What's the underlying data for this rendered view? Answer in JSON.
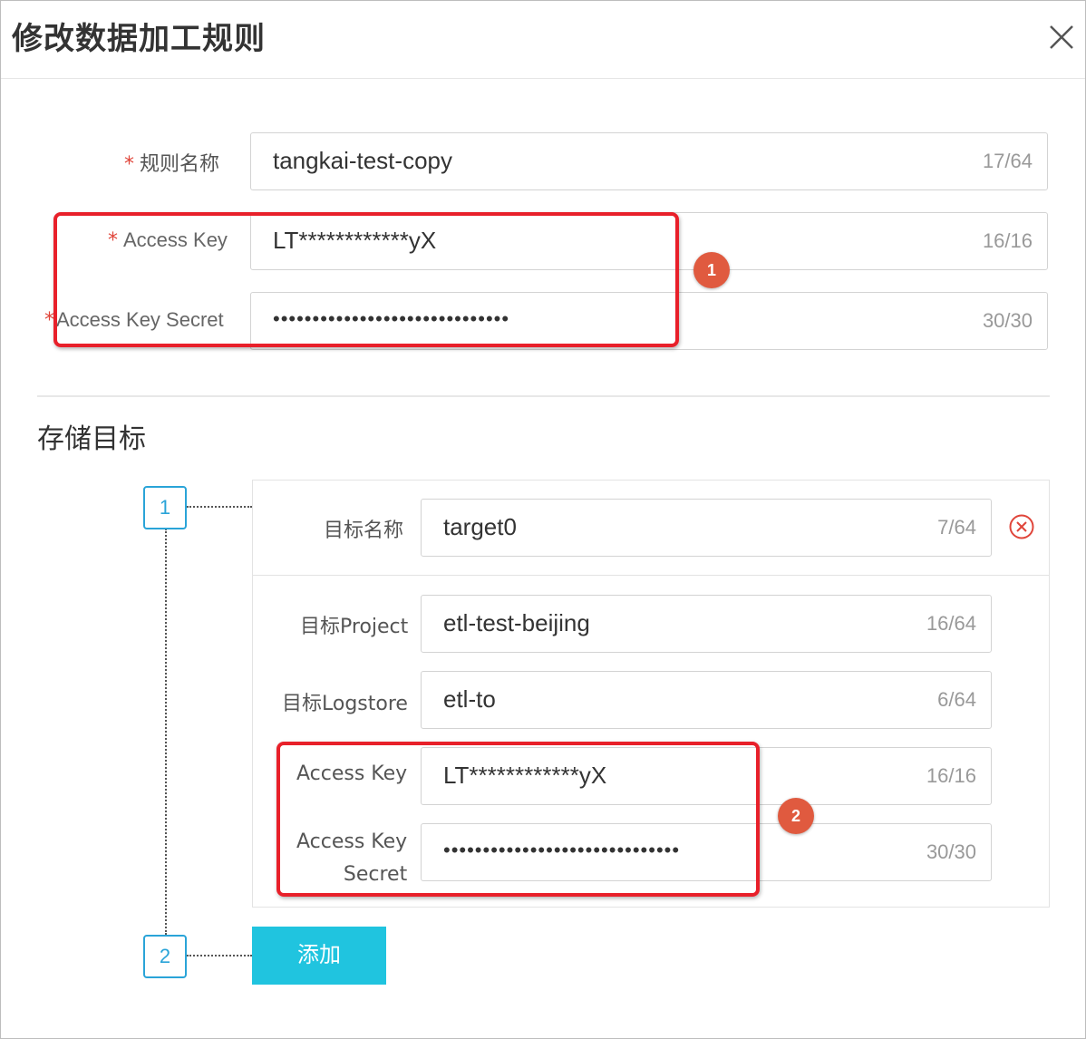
{
  "dialog": {
    "title": "修改数据加工规则",
    "close_icon": "close-icon"
  },
  "rule": {
    "name": {
      "label": "规则名称",
      "value": "tangkai-test-copy",
      "count": "17/64",
      "required": "*"
    },
    "access_key": {
      "label": "Access Key",
      "value": "LT************yX",
      "count": "16/16",
      "required": "*"
    },
    "access_key_secret": {
      "label": "Access Key Secret",
      "value": "••••••••••••••••••••••••••••••",
      "count": "30/30",
      "required": "*"
    }
  },
  "storage": {
    "section_title": "存储目标",
    "steps": [
      "1",
      "2"
    ],
    "target": {
      "name": {
        "label": "目标名称",
        "value": "target0",
        "count": "7/64"
      },
      "project": {
        "label": "目标Project",
        "value": "etl-test-beijing",
        "count": "16/64"
      },
      "logstore": {
        "label": "目标Logstore",
        "value": "etl-to",
        "count": "6/64"
      },
      "access_key": {
        "label": "Access Key",
        "value": "LT************yX",
        "count": "16/16"
      },
      "access_key_secret": {
        "label_line1": "Access Key",
        "label_line2": "Secret",
        "value": "••••••••••••••••••••••••••••••",
        "count": "30/30"
      }
    },
    "add_label": "添加"
  },
  "annotations": {
    "badge_1": "1",
    "badge_2": "2",
    "highlight_color": "#e8202a",
    "badge_color": "#e05a3f"
  },
  "colors": {
    "accent": "#20c4df",
    "step_border": "#2aa4d8",
    "required": "#e0453a",
    "remove": "#e0453a"
  }
}
